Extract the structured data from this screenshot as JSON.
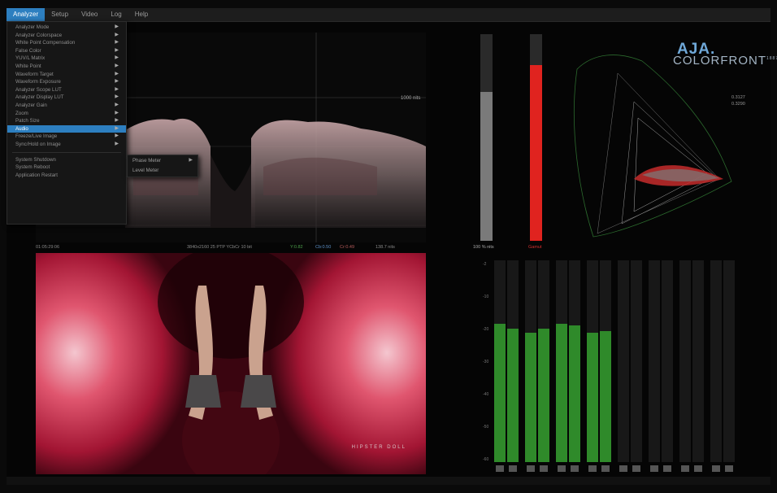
{
  "menubar": {
    "items": [
      {
        "label": "Analyzer",
        "active": true
      },
      {
        "label": "Setup",
        "active": false
      },
      {
        "label": "Video",
        "active": false
      },
      {
        "label": "Log",
        "active": false
      },
      {
        "label": "Help",
        "active": false
      }
    ]
  },
  "analyzer_menu": {
    "items": [
      {
        "label": "Analyzer Mode",
        "submenu": true
      },
      {
        "label": "Analyzer Colorspace",
        "submenu": true
      },
      {
        "label": "White Point Compensation",
        "submenu": true
      },
      {
        "label": "False Color",
        "submenu": true
      },
      {
        "label": "YUV/L Matrix",
        "submenu": true
      },
      {
        "label": "White Point",
        "submenu": true
      },
      {
        "label": "Waveform Target",
        "submenu": true
      },
      {
        "label": "Waveform Exposure",
        "submenu": true
      },
      {
        "label": "Analyzer Scope LUT",
        "submenu": true
      },
      {
        "label": "Analyzer Display LUT",
        "submenu": true
      },
      {
        "label": "Analyzer Gain",
        "submenu": true
      },
      {
        "label": "Zoom",
        "submenu": true
      },
      {
        "label": "Patch Size",
        "submenu": true
      },
      {
        "label": "Audio",
        "submenu": true,
        "highlighted": true
      },
      {
        "label": "Freeze/Live Image",
        "submenu": true
      },
      {
        "label": "Sync/Hold on Image",
        "submenu": true
      }
    ],
    "system_items": [
      "System Shutdown",
      "System Reboot",
      "Application Restart"
    ]
  },
  "audio_submenu": {
    "items": [
      {
        "label": "Phase Meter",
        "submenu": true
      },
      {
        "label": "Level Meter",
        "submenu": false
      }
    ]
  },
  "waveform": {
    "nits_label": "1000 nits",
    "status": {
      "timecode": "01:05:29:06",
      "format": "3840x2160 25 PTP  YCbCr  10 bit",
      "y_value": "Y:0.82",
      "cb_value": "Cb:0.50",
      "cr_value": "Cr:0.49",
      "nits_value": "138.7 nits"
    }
  },
  "meters": {
    "left_label": "100 % nits",
    "right_label": "Gamut",
    "left_level": 0.72,
    "right_level": 0.85
  },
  "cie": {
    "values": [
      "0.3127",
      "0.3290"
    ],
    "brand_aja": "AJA.",
    "brand_colorfront": "COLORFRONT",
    "brand_suffix": "1887"
  },
  "image": {
    "watermark": "HIPSTER DOLL"
  },
  "audio": {
    "db_labels": [
      "-2",
      "-10",
      "-20",
      "-30",
      "-40",
      "-50",
      "-60"
    ],
    "channels": [
      {
        "level": 0.88
      },
      {
        "level": 0.85
      },
      {
        "level": 0.82
      },
      {
        "level": 0.85
      },
      {
        "level": 0.88
      },
      {
        "level": 0.87
      },
      {
        "level": 0.82
      },
      {
        "level": 0.83
      },
      {
        "level": 0
      },
      {
        "level": 0
      },
      {
        "level": 0
      },
      {
        "level": 0
      },
      {
        "level": 0
      },
      {
        "level": 0
      },
      {
        "level": 0
      },
      {
        "level": 0
      }
    ],
    "colors": {
      "active": "#2f8a2a",
      "inactive": "#1a1a1a"
    }
  }
}
